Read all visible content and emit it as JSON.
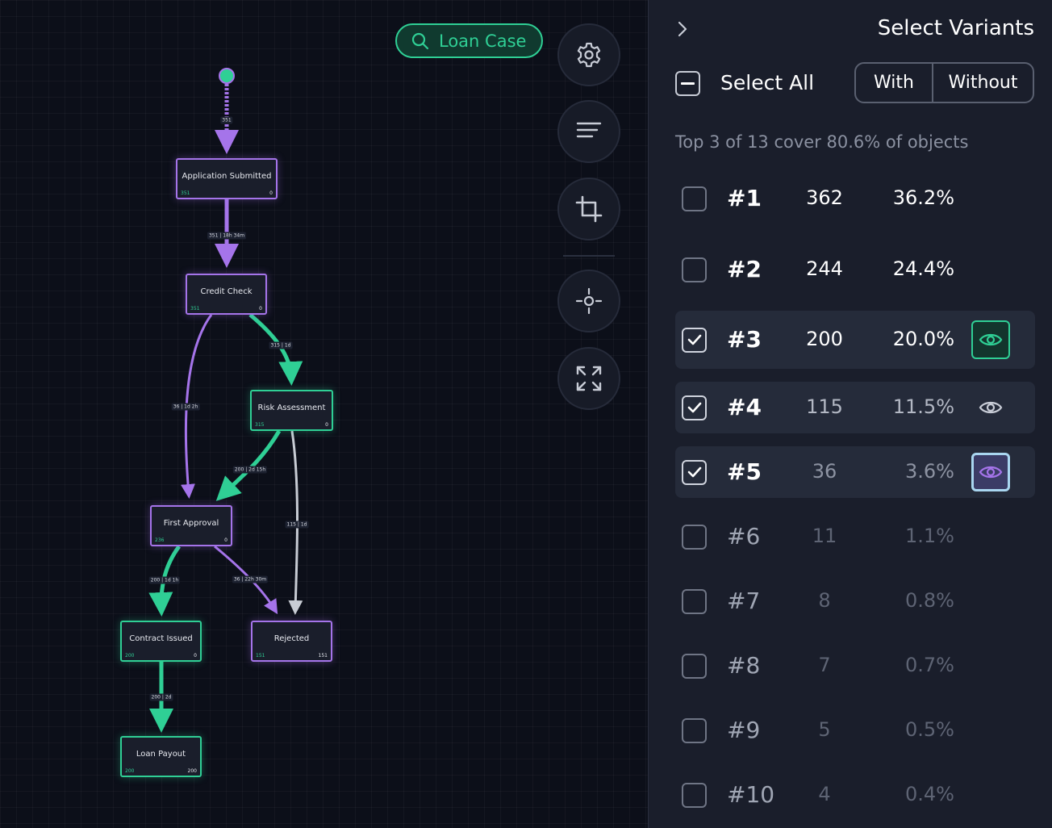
{
  "search": {
    "label": "Loan Case"
  },
  "toolbar": {
    "settings_icon": "gear-icon",
    "filter_icon": "sort-lines-icon",
    "crop_icon": "crop-icon",
    "locate_icon": "crosshair-icon",
    "fit_icon": "expand-arrows-icon"
  },
  "colors": {
    "accent_green": "#2fcf95",
    "accent_purple": "#a574ea",
    "neutral_edge": "#b8bcc6"
  },
  "graph": {
    "nodes": [
      {
        "id": "app",
        "label": "Application Submitted",
        "left": "351",
        "right": "0",
        "color": "purple"
      },
      {
        "id": "credit",
        "label": "Credit Check",
        "left": "351",
        "right": "0",
        "color": "purple"
      },
      {
        "id": "risk",
        "label": "Risk Assessment",
        "left": "315",
        "right": "0",
        "color": "green"
      },
      {
        "id": "first",
        "label": "First Approval",
        "left": "236",
        "right": "0",
        "color": "purple"
      },
      {
        "id": "contract",
        "label": "Contract Issued",
        "left": "200",
        "right": "0",
        "color": "green"
      },
      {
        "id": "rejected",
        "label": "Rejected",
        "left": "151",
        "right": "151",
        "color": "purple"
      },
      {
        "id": "payout",
        "label": "Loan Payout",
        "left": "200",
        "right": "200",
        "color": "green"
      }
    ],
    "edges": [
      {
        "id": "start-app",
        "label": "351"
      },
      {
        "id": "app-credit",
        "label": "351 | 18h 34m"
      },
      {
        "id": "credit-risk",
        "label": "315 | 1d"
      },
      {
        "id": "credit-first",
        "label": "36 | 1d 2h"
      },
      {
        "id": "risk-first",
        "label": "200 | 2d 15h"
      },
      {
        "id": "risk-rejected",
        "label": "115 | 1d"
      },
      {
        "id": "first-contract",
        "label": "200 | 1d 1h"
      },
      {
        "id": "first-rejected",
        "label": "36 | 22h 30m"
      },
      {
        "id": "contract-payout",
        "label": "200 | 2d"
      }
    ]
  },
  "panel": {
    "title": "Select Variants",
    "select_all_label": "Select All",
    "toggle_with": "With",
    "toggle_without": "Without",
    "coverage_text": "Top 3 of 13 cover 80.6% of objects",
    "variants": [
      {
        "id": "#1",
        "count": "362",
        "pct": "36.2%",
        "checked": false,
        "eye": "none"
      },
      {
        "id": "#2",
        "count": "244",
        "pct": "24.4%",
        "checked": false,
        "eye": "none"
      },
      {
        "id": "#3",
        "count": "200",
        "pct": "20.0%",
        "checked": true,
        "eye": "green"
      },
      {
        "id": "#4",
        "count": "115",
        "pct": "11.5%",
        "checked": true,
        "eye": "plain"
      },
      {
        "id": "#5",
        "count": "36",
        "pct": "3.6%",
        "checked": true,
        "eye": "purple"
      },
      {
        "id": "#6",
        "count": "11",
        "pct": "1.1%",
        "checked": false,
        "eye": "none"
      },
      {
        "id": "#7",
        "count": "8",
        "pct": "0.8%",
        "checked": false,
        "eye": "none"
      },
      {
        "id": "#8",
        "count": "7",
        "pct": "0.7%",
        "checked": false,
        "eye": "none"
      },
      {
        "id": "#9",
        "count": "5",
        "pct": "0.5%",
        "checked": false,
        "eye": "none"
      },
      {
        "id": "#10",
        "count": "4",
        "pct": "0.4%",
        "checked": false,
        "eye": "none"
      }
    ]
  }
}
